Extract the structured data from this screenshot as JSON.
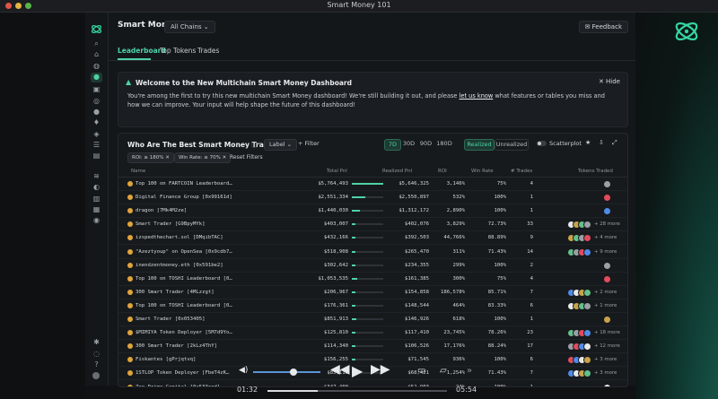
{
  "window": {
    "title": "Smart Money 101"
  },
  "header": {
    "title": "Smart Money",
    "chain": "All Chains ⌄",
    "feedback": "Feedback"
  },
  "tabs": [
    {
      "label": "Leaderboard"
    },
    {
      "label": "Top Tokens"
    },
    {
      "label": "Trades"
    }
  ],
  "banner": {
    "title": "Welcome to the New Multichain Smart Money Dashboard",
    "hide": "Hide",
    "text_a": "You're among the first to try this new multichain Smart Money dashboard! We're still building it out, and please ",
    "link": "let us know",
    "text_b": " what features or tables you miss and how we can improve. Your input will help shape the future of this dashboard!"
  },
  "panel": {
    "title": "Who Are The Best Smart Money Traders?",
    "label_btn": "Label ⌄",
    "filter_btn": "+ Filter",
    "periods": [
      "7D",
      "30D",
      "90D",
      "180D"
    ],
    "active_period": "7D",
    "modes": [
      "Realized",
      "Unrealized"
    ],
    "active_mode": "Realized",
    "scatterplot": "Scatterplot",
    "chips": [
      "ROI: ≥ 180%",
      "Win Rate: ≥ 70%"
    ],
    "reset": "Reset Filters",
    "columns": [
      "Name",
      "Total Pnl",
      "Realized Pnl",
      "ROI",
      "Win Rate",
      "# Trades",
      "Tokens Traded"
    ]
  },
  "rows": [
    {
      "name": "Top 100 on FARTCOIN Leaderboard…",
      "total": "$5,764,493",
      "realized": "$5,646,325",
      "roi": "3,146%",
      "win": "75%",
      "trades": "4",
      "more": "",
      "pnl": 1.0
    },
    {
      "name": "Digital Finance Group [0x99161d]",
      "total": "$2,551,334",
      "realized": "$2,550,897",
      "roi": "532%",
      "win": "100%",
      "trades": "1",
      "more": "",
      "pnl": 0.44
    },
    {
      "name": "dragon [7Mk4M2ze]",
      "total": "$1,440,030",
      "realized": "$1,312,172",
      "roi": "2,890%",
      "win": "100%",
      "trades": "1",
      "more": "",
      "pnl": 0.25
    },
    {
      "name": "Smart Trader [G9BpyMYk]",
      "total": "$403,007",
      "realized": "$402,076",
      "roi": "3,829%",
      "win": "72.73%",
      "trades": "33",
      "more": "+ 28 more",
      "pnl": 0.07
    },
    {
      "name": "izspedthechart.sol [DMqibTAC]",
      "total": "$432,166",
      "realized": "$392,503",
      "roi": "44,766%",
      "win": "88.89%",
      "trades": "9",
      "more": "+ 4 more",
      "pnl": 0.075
    },
    {
      "name": "\"Azeztyoup\" on OpenSea [0x9cdb7…",
      "total": "$518,908",
      "realized": "$265,470",
      "roi": "311%",
      "win": "71.43%",
      "trades": "14",
      "more": "+ 9 more",
      "pnl": 0.09
    },
    {
      "name": "inendzentmoney.eth [0x591be2]",
      "total": "$302,642",
      "realized": "$234,355",
      "roi": "299%",
      "win": "100%",
      "trades": "2",
      "more": "",
      "pnl": 0.055
    },
    {
      "name": "Top 100 on TOSHI Leaderboard [0…",
      "total": "$1,053,535",
      "realized": "$161,385",
      "roi": "300%",
      "win": "75%",
      "trades": "4",
      "more": "",
      "pnl": 0.18
    },
    {
      "name": "300 Smart Trader [4MLzzgt]",
      "total": "$206,967",
      "realized": "$154,858",
      "roi": "186,578%",
      "win": "85.71%",
      "trades": "7",
      "more": "+ 2 more",
      "pnl": 0.04
    },
    {
      "name": "Top 100 on TOSHI Leaderboard [0…",
      "total": "$176,361",
      "realized": "$148,544",
      "roi": "464%",
      "win": "83.33%",
      "trades": "6",
      "more": "+ 1 more",
      "pnl": 0.03
    },
    {
      "name": "Smart Trader [0x053405]",
      "total": "$851,913",
      "realized": "$146,926",
      "roi": "618%",
      "win": "100%",
      "trades": "1",
      "more": "",
      "pnl": 0.15
    },
    {
      "name": "$MIMIYA Token Deployer [5M7d9Yo…",
      "total": "$125,810",
      "realized": "$117,410",
      "roi": "23,745%",
      "win": "78.26%",
      "trades": "23",
      "more": "+ 18 more",
      "pnl": 0.022
    },
    {
      "name": "300 Smart Trader [2kLz4ThY]",
      "total": "$114,340",
      "realized": "$106,526",
      "roi": "17,176%",
      "win": "88.24%",
      "trades": "17",
      "more": "+ 12 more",
      "pnl": 0.02
    },
    {
      "name": "Fiskantes [gPrjqtvq]",
      "total": "$156,255",
      "realized": "$71,545",
      "roi": "936%",
      "win": "100%",
      "trades": "6",
      "more": "+ 3 more",
      "pnl": 0.027
    },
    {
      "name": "1STLOP Token Deployer [FbeT4zK…",
      "total": "$85,110",
      "realized": "$68,421",
      "roi": "1,254%",
      "win": "71.43%",
      "trades": "7",
      "more": "+ 3 more",
      "pnl": 0.015
    },
    {
      "name": "Zee Prime Capital [0x533eed]",
      "total": "$347,400",
      "realized": "$52,903",
      "roi": "24%",
      "win": "100%",
      "trades": "1",
      "more": "",
      "pnl": 0.06
    }
  ],
  "player": {
    "elapsed": "01:32",
    "remaining": "05:54",
    "progress": 0.28,
    "volume": 0.6
  }
}
